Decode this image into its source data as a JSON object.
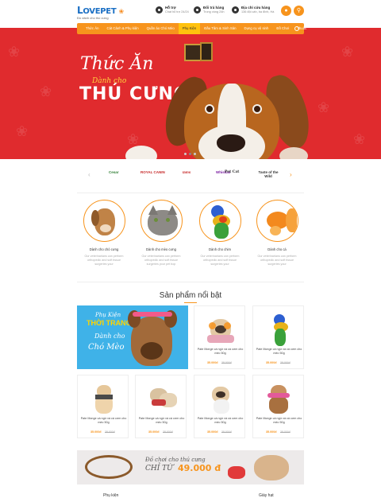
{
  "header": {
    "logo_main": "OVEPET",
    "logo_sub": "Đồ dành cho thú cưng",
    "info": [
      {
        "title": "Hỗ trợ",
        "sub": "Chat hỗ trợ 24/24",
        "icon": "headset-icon"
      },
      {
        "title": "Đổi trả hàng",
        "sub": "Trong vòng 24h",
        "icon": "return-icon"
      },
      {
        "title": "Địa chỉ cửa hàng",
        "sub": "136 đội cấn, ba đình, Hà",
        "icon": "location-icon"
      }
    ],
    "user_icon": "user-icon",
    "cart_icon": "cart-icon"
  },
  "nav": {
    "items": [
      "Thức Ăn",
      "Cát Cảnh & Phụ kiện",
      "Quần áo Chó Mèo",
      "Phụ Kiện",
      "Đầu Tâm & Sinh Sản",
      "Dụng cụ vệ sinh",
      "Đồ Chơi",
      "Thuốc"
    ],
    "active_index": 3
  },
  "hero": {
    "title1": "Thức Ăn",
    "title2": "Dành cho",
    "title3": "THÚ CƯNG",
    "slide_count": 3,
    "active_slide": 1
  },
  "brands": [
    "Cesar",
    "ROYAL CANIN",
    "Iams",
    "Whiskas",
    "Pet Cat",
    "Taste of the Wild"
  ],
  "categories": [
    {
      "title": "Dành cho chó cưng",
      "desc": "Our veterinarians can perform orthopedic and soft tissue surgeries your"
    },
    {
      "title": "Dành cho mèo cưng",
      "desc": "Our veterinarians can perform orthopedic and soft tissue surgeries your pet bop"
    },
    {
      "title": "Dành cho chim",
      "desc": "Our veterinarians can perform orthopedic and soft tissue surgeries your"
    },
    {
      "title": "Dành cho cá",
      "desc": "Our veterinarians can perform orthopedic and soft tissue surgeries your"
    }
  ],
  "featured": {
    "title": "Sản phẩm nổi bật",
    "banner": {
      "t1": "Phụ Kiện",
      "t2": "THỜI TRANG",
      "t3": "Dành cho",
      "t4": "Chó Mèo"
    },
    "products": [
      {
        "name": "Pate Monge cá ngừ và cá cơm cho mèo 50g",
        "price": "35.000đ",
        "old": "38.000đ"
      },
      {
        "name": "Pate Monge cá ngừ và cá cơm cho mèo 50g",
        "price": "35.000đ",
        "old": "38.000đ"
      },
      {
        "name": "Pate Monge cá ngừ và cá cơm cho mèo 50g",
        "price": "35.000đ",
        "old": "38.000đ"
      },
      {
        "name": "Pate Monge cá ngừ và cá cơm cho mèo 50g",
        "price": "35.000đ",
        "old": "38.000đ"
      },
      {
        "name": "Pate Monge cá ngừ và cá cơm cho mèo 50g",
        "price": "35.000đ",
        "old": "38.000đ"
      },
      {
        "name": "Pate Monge cá ngừ và cá cơm cho mèo 50g",
        "price": "35.000đ",
        "old": "38.000đ"
      }
    ]
  },
  "promo": {
    "t1": "Đồ chơi cho thú cưng",
    "t2": "CHỈ TỪ",
    "t3": "49.000 đ"
  },
  "footer": {
    "left": "Phụ kiện",
    "right": "Giày hạt"
  }
}
